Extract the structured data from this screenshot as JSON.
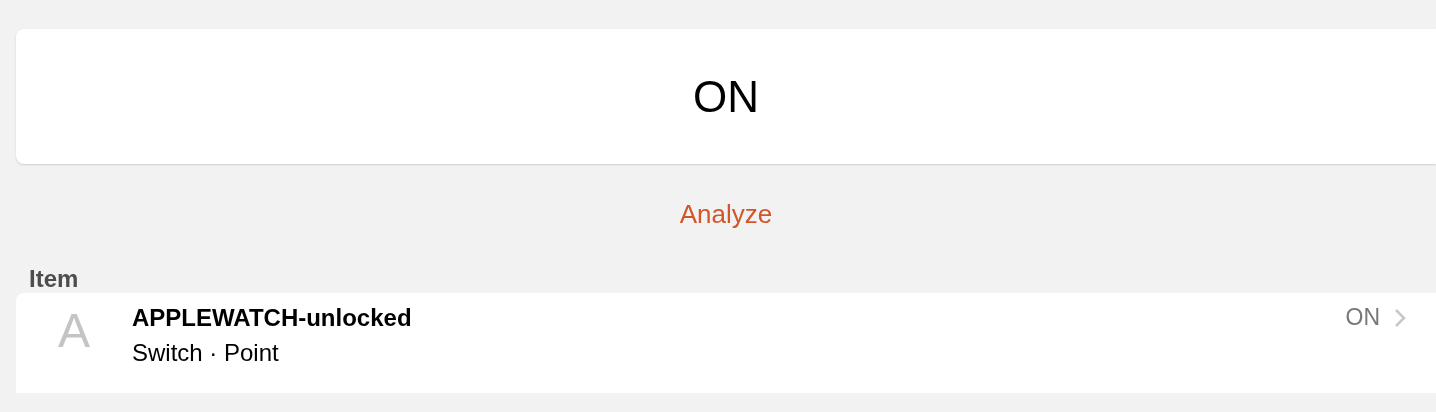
{
  "state_card": {
    "value": "ON"
  },
  "analyze_link": "Analyze",
  "section": {
    "header": "Item",
    "items": [
      {
        "icon_letter": "A",
        "title": "APPLEWATCH-unlocked",
        "subtitle": "Switch · Point",
        "state": "ON"
      }
    ]
  }
}
